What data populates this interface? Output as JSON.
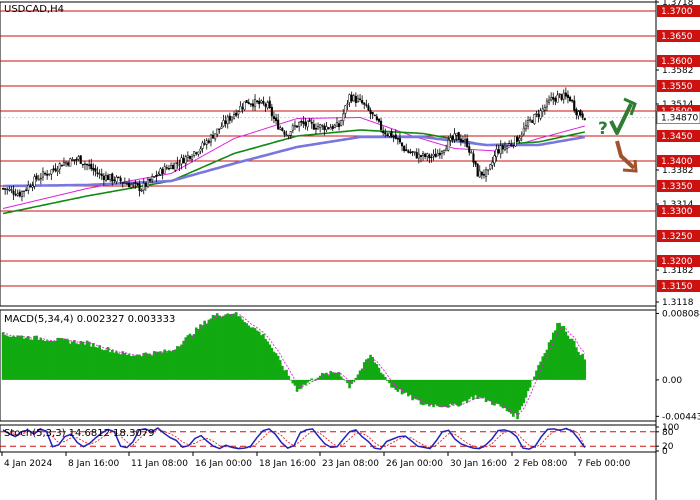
{
  "chart_data": [
    {
      "type": "candlestick",
      "title": "USDCAD,H4",
      "ylim": [
        1.311,
        1.3718
      ],
      "highlighted_levels": [
        "1.3700",
        "1.3650",
        "1.3600",
        "1.3550",
        "1.3500",
        "1.3450",
        "1.3400",
        "1.3350",
        "1.3300",
        "1.3250",
        "1.3200",
        "1.3150"
      ],
      "axis_ticks": [
        "1.3718",
        "1.3582",
        "1.3514",
        "1.3382",
        "1.3314",
        "1.3182",
        "1.3118"
      ],
      "current_price": "1.34870",
      "x_tick_labels": [
        "4 Jan 2024",
        "8 Jan 16:00",
        "11 Jan 08:00",
        "16 Jan 00:00",
        "18 Jan 16:00",
        "23 Jan 08:00",
        "26 Jan 00:00",
        "30 Jan 16:00",
        "2 Feb 08:00",
        "7 Feb 00:00"
      ],
      "close_path": [
        [
          0,
          1.3345
        ],
        [
          8,
          1.3335
        ],
        [
          16,
          1.3365
        ],
        [
          22,
          1.3378
        ],
        [
          28,
          1.3395
        ],
        [
          36,
          1.3405
        ],
        [
          46,
          1.3372
        ],
        [
          56,
          1.336
        ],
        [
          66,
          1.3345
        ],
        [
          76,
          1.3382
        ],
        [
          84,
          1.3398
        ],
        [
          95,
          1.343
        ],
        [
          106,
          1.3478
        ],
        [
          116,
          1.352
        ],
        [
          126,
          1.351
        ],
        [
          130,
          1.3475
        ],
        [
          135,
          1.3455
        ],
        [
          141,
          1.3475
        ],
        [
          148,
          1.347
        ],
        [
          154,
          1.3468
        ],
        [
          160,
          1.347
        ],
        [
          165,
          1.353
        ],
        [
          171,
          1.3515
        ],
        [
          176,
          1.349
        ],
        [
          181,
          1.346
        ],
        [
          186,
          1.345
        ],
        [
          192,
          1.342
        ],
        [
          198,
          1.341
        ],
        [
          205,
          1.3408
        ],
        [
          211,
          1.3432
        ],
        [
          216,
          1.345
        ],
        [
          221,
          1.3435
        ],
        [
          226,
          1.3375
        ],
        [
          231,
          1.3375
        ],
        [
          235,
          1.342
        ],
        [
          240,
          1.343
        ],
        [
          245,
          1.3445
        ],
        [
          251,
          1.348
        ],
        [
          256,
          1.3498
        ],
        [
          261,
          1.3522
        ],
        [
          265,
          1.353
        ],
        [
          270,
          1.3525
        ],
        [
          273,
          1.35
        ],
        [
          277,
          1.349
        ]
      ],
      "series": [
        {
          "name": "",
          "color": "#dd22dd",
          "points": [
            [
              0,
              1.3305
            ],
            [
              40,
              1.3345
            ],
            [
              80,
              1.3375
            ],
            [
              110,
              1.3445
            ],
            [
              140,
              1.3485
            ],
            [
              170,
              1.3487
            ],
            [
              195,
              1.345
            ],
            [
              215,
              1.3425
            ],
            [
              235,
              1.342
            ],
            [
              255,
              1.3445
            ],
            [
              277,
              1.347
            ]
          ]
        },
        {
          "name": "",
          "color": "#118811",
          "points": [
            [
              0,
              1.3295
            ],
            [
              40,
              1.333
            ],
            [
              80,
              1.336
            ],
            [
              110,
              1.3415
            ],
            [
              140,
              1.345
            ],
            [
              170,
              1.3462
            ],
            [
              200,
              1.3455
            ],
            [
              230,
              1.3432
            ],
            [
              255,
              1.3438
            ],
            [
              277,
              1.3458
            ]
          ]
        },
        {
          "name": "",
          "color": "#7777dd",
          "points": [
            [
              0,
              1.335
            ],
            [
              40,
              1.3352
            ],
            [
              80,
              1.336
            ],
            [
              110,
              1.3395
            ],
            [
              140,
              1.3428
            ],
            [
              170,
              1.3448
            ],
            [
              200,
              1.3448
            ],
            [
              230,
              1.3432
            ],
            [
              255,
              1.3432
            ],
            [
              277,
              1.3448
            ]
          ]
        }
      ]
    },
    {
      "type": "bar",
      "title": "MACD(5,34,4) 0.002327 0.003333",
      "ylim": [
        -0.005,
        0.0085
      ],
      "axis_ticks": [
        "0.008084",
        "0.00",
        "-0.004434"
      ],
      "bar_color": "#11aa11",
      "signal_color": "#dd22dd",
      "path": [
        [
          0,
          0.0055
        ],
        [
          20,
          0.005
        ],
        [
          40,
          0.0045
        ],
        [
          60,
          0.003
        ],
        [
          80,
          0.0035
        ],
        [
          100,
          0.0078
        ],
        [
          110,
          0.0082
        ],
        [
          125,
          0.0052
        ],
        [
          140,
          -0.0012
        ],
        [
          150,
          0.0005
        ],
        [
          160,
          0.001
        ],
        [
          165,
          -0.0008
        ],
        [
          175,
          0.003
        ],
        [
          185,
          -0.0008
        ],
        [
          200,
          -0.003
        ],
        [
          215,
          -0.0032
        ],
        [
          225,
          -0.002
        ],
        [
          235,
          -0.003
        ],
        [
          245,
          -0.0045
        ],
        [
          255,
          0.0018
        ],
        [
          265,
          0.0072
        ],
        [
          277,
          0.0025
        ]
      ]
    },
    {
      "type": "line",
      "title": "Stoch(5,3,3) 14.6812 18.3079",
      "ylim": [
        0,
        100
      ],
      "axis_ticks": [
        "100",
        "80",
        "20",
        "0"
      ],
      "levels": [
        80,
        20
      ],
      "k": [
        88,
        72,
        60,
        80,
        88,
        70,
        92,
        82,
        18,
        26,
        60,
        70,
        35,
        18,
        32,
        56,
        76,
        90,
        80,
        20,
        14,
        38,
        88,
        92,
        80,
        96,
        74,
        56,
        44,
        16,
        22,
        52,
        64,
        40,
        20,
        10,
        24,
        15,
        10,
        12,
        20,
        55,
        85,
        92,
        70,
        35,
        12,
        22,
        75,
        88,
        92,
        60,
        30,
        15,
        18,
        50,
        80,
        88,
        60,
        40,
        12,
        8,
        40,
        50,
        60,
        62,
        42,
        20,
        15,
        10,
        42,
        80,
        86,
        50,
        30,
        20,
        12,
        10,
        25,
        50,
        85,
        88,
        80,
        60,
        12,
        8,
        20,
        60,
        90,
        92,
        86,
        94,
        82,
        50,
        14
      ],
      "d": [
        84,
        78,
        68,
        70,
        80,
        78,
        84,
        86,
        60,
        34,
        40,
        55,
        55,
        40,
        28,
        38,
        56,
        74,
        82,
        62,
        38,
        24,
        50,
        76,
        86,
        88,
        82,
        72,
        58,
        38,
        26,
        32,
        46,
        52,
        40,
        22,
        18,
        16,
        14,
        12,
        14,
        30,
        55,
        80,
        82,
        64,
        38,
        22,
        40,
        64,
        84,
        78,
        58,
        36,
        20,
        28,
        50,
        74,
        74,
        60,
        36,
        18,
        22,
        36,
        50,
        58,
        54,
        38,
        24,
        14,
        24,
        48,
        72,
        70,
        52,
        32,
        20,
        14,
        16,
        30,
        56,
        78,
        84,
        74,
        48,
        24,
        14,
        30,
        60,
        82,
        90,
        90,
        88,
        74,
        18
      ]
    }
  ],
  "forecast": {
    "question_mark": "?",
    "up_color": "#2e7d32",
    "down_color": "#a0522d"
  }
}
